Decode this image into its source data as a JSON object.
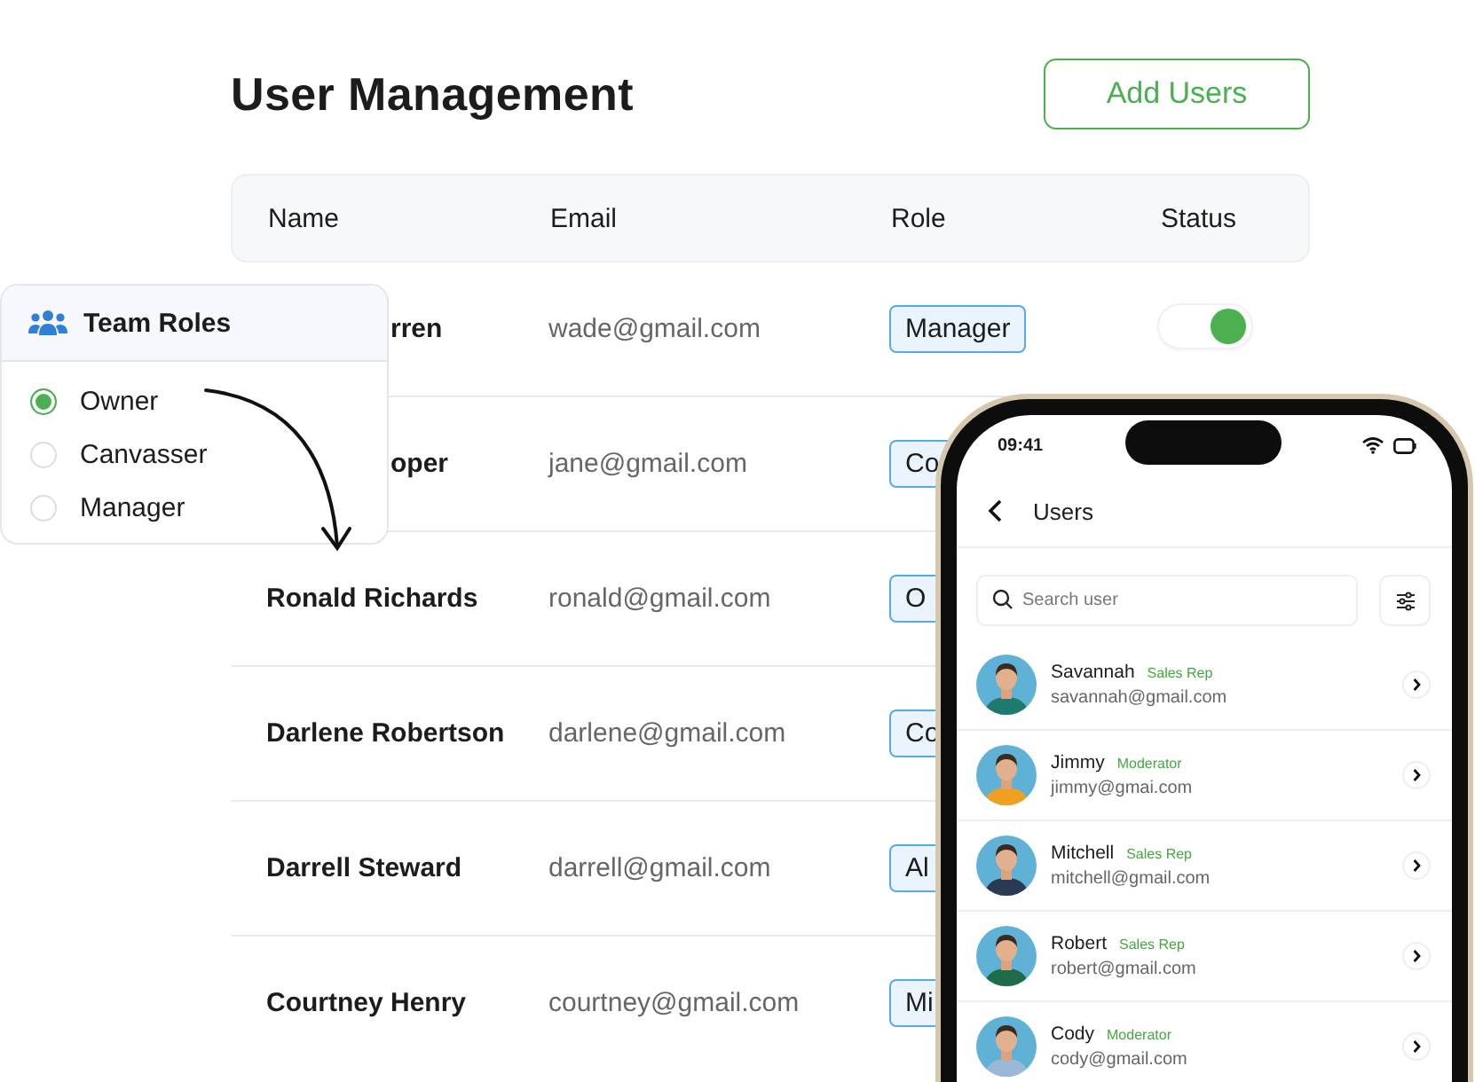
{
  "page": {
    "title": "User Management",
    "add_button": "Add Users"
  },
  "table": {
    "columns": [
      "Name",
      "Email",
      "Role",
      "Status"
    ],
    "rows": [
      {
        "name": "rren",
        "email": "wade@gmail.com",
        "role": "Manager",
        "on": true
      },
      {
        "name": "oper",
        "email": "jane@gmail.com",
        "role": "Co"
      },
      {
        "name": "Ronald Richards",
        "email": "ronald@gmail.com",
        "role": "O"
      },
      {
        "name": "Darlene Robertson",
        "email": "darlene@gmail.com",
        "role": "Co"
      },
      {
        "name": "Darrell Steward",
        "email": "darrell@gmail.com",
        "role": "Al"
      },
      {
        "name": "Courtney Henry",
        "email": "courtney@gmail.com",
        "role": "Mi"
      }
    ]
  },
  "team_roles": {
    "title": "Team Roles",
    "options": [
      {
        "label": "Owner",
        "selected": true
      },
      {
        "label": "Canvasser",
        "selected": false
      },
      {
        "label": "Manager",
        "selected": false
      }
    ]
  },
  "phone": {
    "time": "09:41",
    "title": "Users",
    "search": {
      "placeholder": "Search user"
    },
    "users": [
      {
        "name": "Savannah",
        "role": "Sales Rep",
        "email": "savannah@gmail.com"
      },
      {
        "name": "Jimmy",
        "role": "Moderator",
        "email": "jimmy@gmai.com"
      },
      {
        "name": "Mitchell",
        "role": "Sales Rep",
        "email": "mitchell@gmail.com"
      },
      {
        "name": "Robert",
        "role": "Sales Rep",
        "email": "robert@gmail.com"
      },
      {
        "name": "Cody",
        "role": "Moderator",
        "email": "cody@gmail.com"
      }
    ]
  }
}
